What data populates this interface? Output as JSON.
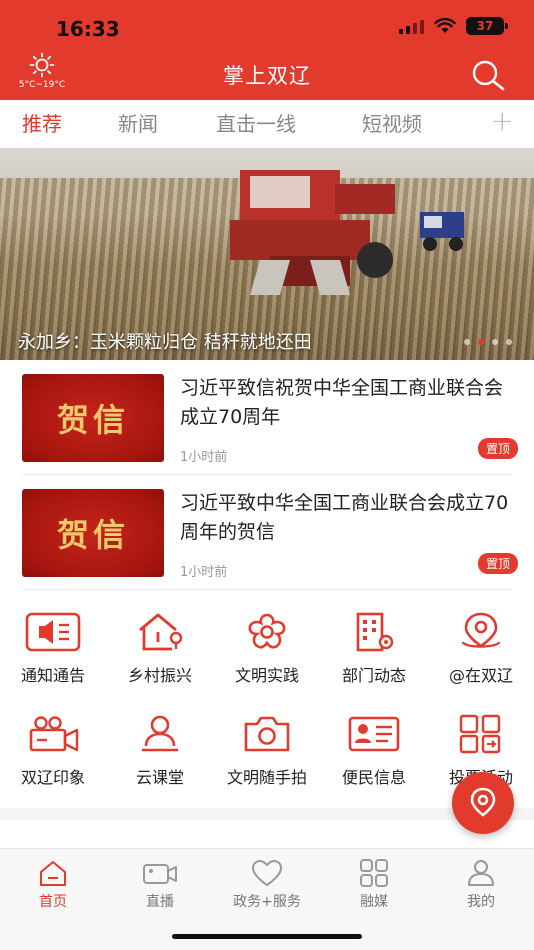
{
  "status_bar": {
    "time": "16:33",
    "battery": "37"
  },
  "header": {
    "title": "掌上双辽",
    "weather": "5°C~19°C"
  },
  "tabs": [
    "推荐",
    "新闻",
    "直击一线",
    "短视频"
  ],
  "tab_add": "+",
  "banner": {
    "caption": "永加乡：玉米颗粒归仓 秸秆就地还田",
    "slide_count": 4,
    "active_slide": 2
  },
  "news": [
    {
      "thumb_text": "贺信",
      "title": "习近平致信祝贺中华全国工商业联合会成立70周年",
      "time": "1小时前",
      "badge": "置顶"
    },
    {
      "thumb_text": "贺信",
      "title": "习近平致中华全国工商业联合会成立70周年的贺信",
      "time": "1小时前",
      "badge": "置顶"
    }
  ],
  "services": [
    {
      "label": "通知通告",
      "icon": "megaphone-icon"
    },
    {
      "label": "乡村振兴",
      "icon": "village-house-icon"
    },
    {
      "label": "文明实践",
      "icon": "flower-icon"
    },
    {
      "label": "部门动态",
      "icon": "building-gear-icon"
    },
    {
      "label": "@在双辽",
      "icon": "location-pin-icon"
    },
    {
      "label": "双辽印象",
      "icon": "video-camera-icon"
    },
    {
      "label": "云课堂",
      "icon": "teacher-icon"
    },
    {
      "label": "文明随手拍",
      "icon": "camera-icon"
    },
    {
      "label": "便民信息",
      "icon": "id-card-icon"
    },
    {
      "label": "投票活动",
      "icon": "vote-grid-icon"
    }
  ],
  "bottom_nav": [
    {
      "label": "首页",
      "icon": "home-icon"
    },
    {
      "label": "直播",
      "icon": "live-camera-icon"
    },
    {
      "label": "政务+服务",
      "icon": "heart-icon"
    },
    {
      "label": "融媒",
      "icon": "grid-icon"
    },
    {
      "label": "我的",
      "icon": "user-icon"
    }
  ],
  "colors": {
    "brand": "#e23a2d",
    "gold": "#f2c96a"
  }
}
